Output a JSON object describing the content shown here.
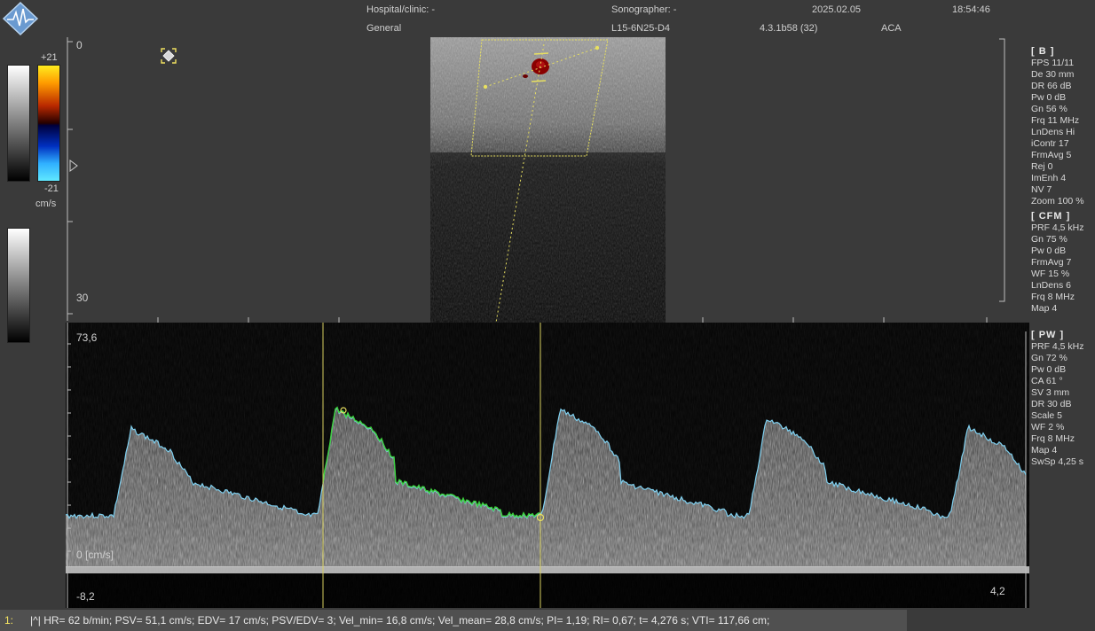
{
  "header": {
    "hospital_label": "Hospital/clinic: -",
    "sonographer_label": "Sonographer: -",
    "date": "2025.02.05",
    "time": "18:54:46",
    "preset": "General",
    "probe": "L15-6N25-D4",
    "version": "4.3.1b58 (32)",
    "exam": "ACA"
  },
  "colorbar": {
    "max": "+21",
    "min": "-21",
    "unit": "cm/s"
  },
  "bmode": {
    "depth_top": "0",
    "depth_bottom": "30"
  },
  "pw_scale": {
    "top": "73,6",
    "baseline": "0 [cm/s]",
    "bottom": "-8,2",
    "time_end": "4,2"
  },
  "params": {
    "b": {
      "title": "[ B ]",
      "items": [
        "FPS 11/11",
        "De 30 mm",
        "DR 66 dB",
        "Pw 0 dB",
        "Gn 56 %",
        "Frq 11 MHz",
        "LnDens Hi",
        "iContr 17",
        "FrmAvg 5",
        "Rej 0",
        "ImEnh 4",
        "NV 7",
        "Zoom 100 %"
      ]
    },
    "cfm": {
      "title": "[ CFM ]",
      "items": [
        "PRF 4,5 kHz",
        "Gn 75 %",
        "Pw 0 dB",
        "FrmAvg 7",
        "WF 15 %",
        "LnDens 6",
        "Frq 8 MHz",
        "Map 4"
      ]
    },
    "pw": {
      "title": "[ PW ]",
      "items": [
        "PRF 4,5 kHz",
        "Gn 72 %",
        "Pw 0 dB",
        "CA 61 °",
        "SV 3 mm",
        "DR 30 dB",
        "Scale 5",
        "WF 2 %",
        "Frq 8 MHz",
        "Map 4",
        "SwSp 4,25 s"
      ]
    }
  },
  "status": {
    "index": "1:",
    "text": "|^| HR= 62 b/min; PSV= 51,1 cm/s; EDV= 17 cm/s; PSV/EDV= 3; Vel_min= 16,8 cm/s; Vel_mean= 28,8 cm/s; PI= 1,19; RI= 0,67; t= 4,276 s; VTI= 117,66 cm;"
  },
  "colors": {
    "background": "#3a3a3a",
    "envelope": "#7fd0f0",
    "trace": "#3ccf3c",
    "caliper": "#e8e060",
    "status_bar": "#505050"
  },
  "icons": {
    "logo": "ultrasound-logo-icon",
    "roi": "roi-selection-icon",
    "depth_marker": "focus-triangle-icon"
  }
}
